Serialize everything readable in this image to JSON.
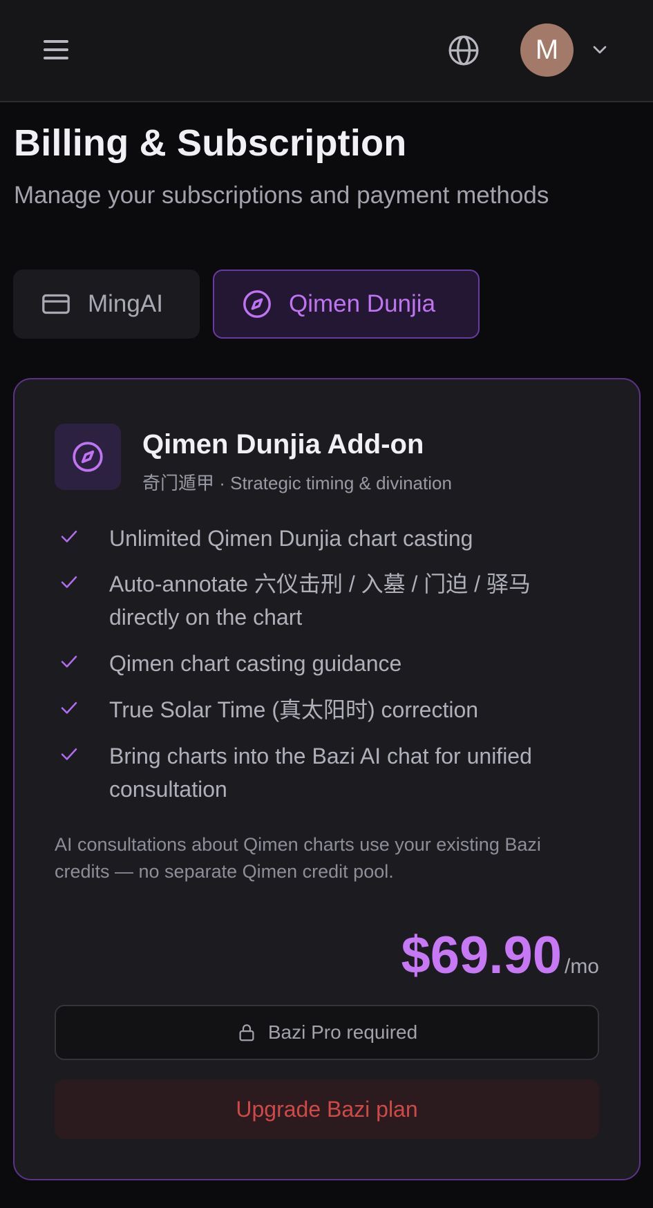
{
  "header": {
    "avatar_initial": "M",
    "icons": {
      "menu": "menu-icon",
      "language": "globe-icon",
      "account_menu": "chevron-down-icon"
    }
  },
  "page": {
    "title": "Billing & Subscription",
    "subtitle": "Manage your subscriptions and payment methods"
  },
  "tabs": [
    {
      "label": "MingAI",
      "icon": "credit-card-icon",
      "active": false
    },
    {
      "label": "Qimen Dunjia",
      "icon": "compass-icon",
      "active": true
    }
  ],
  "addon": {
    "title": "Qimen Dunjia Add-on",
    "subtitle": "奇门遁甲 · Strategic timing & divination",
    "features": [
      "Unlimited Qimen Dunjia chart casting",
      "Auto-annotate 六仪击刑 / 入墓 / 门迫 / 驿马 directly on the chart",
      "Qimen chart casting guidance",
      "True Solar Time (真太阳时) correction",
      "Bring charts into the Bazi AI chat for unified consultation"
    ],
    "note": "AI consultations about Qimen charts use your existing Bazi credits — no separate Qimen credit pool.",
    "price": "$69.90",
    "price_unit": "/mo",
    "required_label": "Bazi Pro required",
    "upgrade_label": "Upgrade Bazi plan"
  },
  "colors": {
    "accent_purple": "#c778f5",
    "danger_red": "#cf4a47",
    "background": "#0b0b0d",
    "card": "#1b1b20"
  }
}
